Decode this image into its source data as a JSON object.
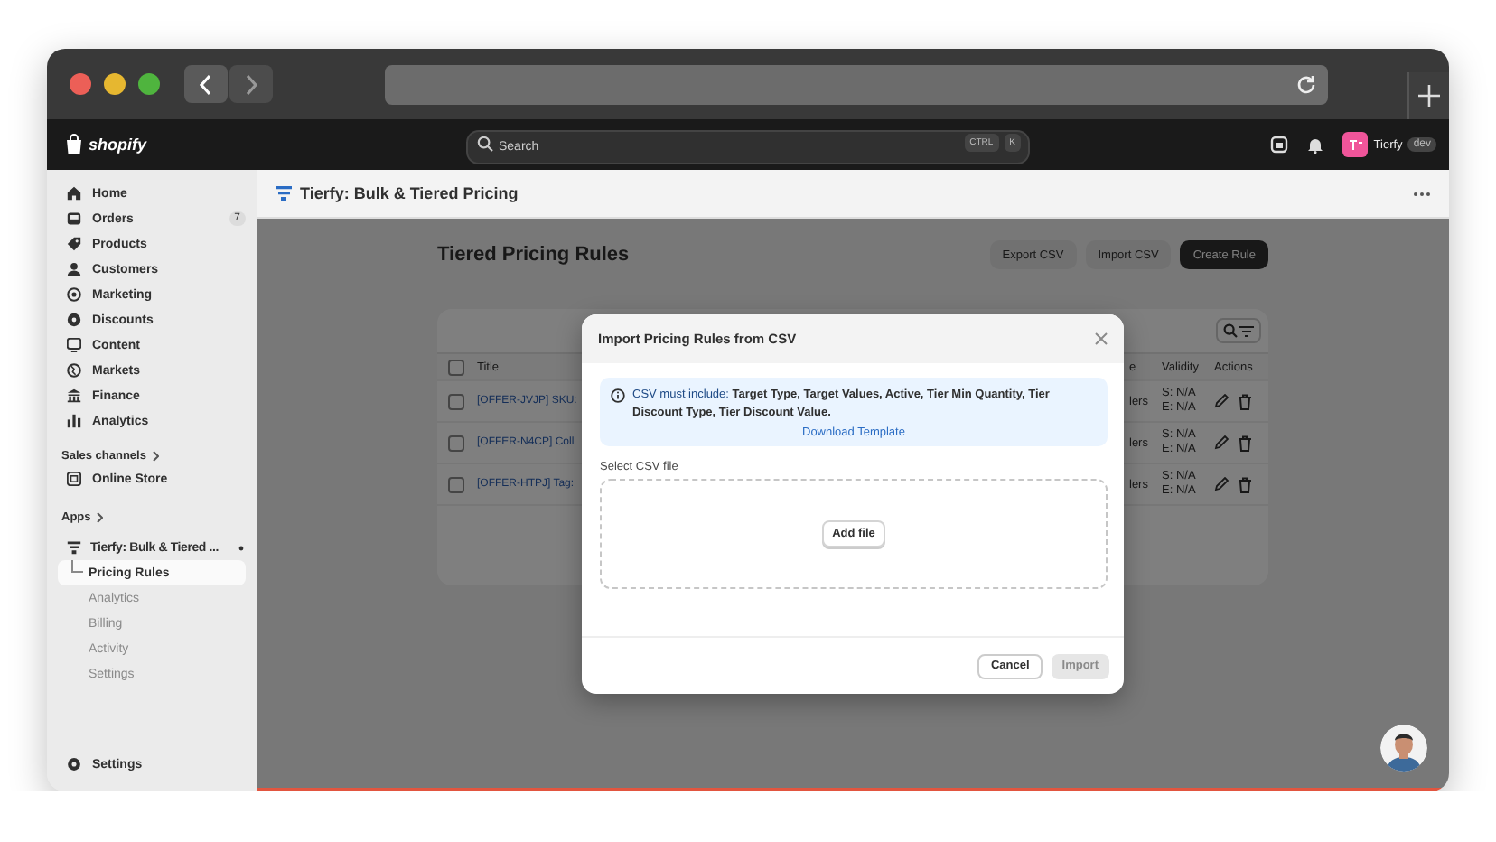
{
  "topbar": {
    "logo_text": "shopify",
    "search": {
      "placeholder": "Search",
      "shortcut": [
        "CTRL",
        "K"
      ]
    },
    "store": {
      "name": "Tierfy",
      "badge": "dev"
    }
  },
  "sidebar": {
    "items": [
      {
        "label": "Home"
      },
      {
        "label": "Orders",
        "badge": "7"
      },
      {
        "label": "Products"
      },
      {
        "label": "Customers"
      },
      {
        "label": "Marketing"
      },
      {
        "label": "Discounts"
      },
      {
        "label": "Content"
      },
      {
        "label": "Markets"
      },
      {
        "label": "Finance"
      },
      {
        "label": "Analytics"
      }
    ],
    "sales_channels": {
      "heading": "Sales channels",
      "items": [
        {
          "label": "Online Store"
        }
      ]
    },
    "apps": {
      "heading": "Apps",
      "items": [
        {
          "label": "Tierfy: Bulk & Tiered ...",
          "expanded": true,
          "children": [
            {
              "label": "Pricing Rules",
              "selected": true
            },
            {
              "label": "Analytics",
              "selected": false
            },
            {
              "label": "Billing",
              "selected": false
            },
            {
              "label": "Activity",
              "selected": false
            },
            {
              "label": "Settings",
              "selected": false
            }
          ]
        }
      ]
    },
    "footer": {
      "label": "Settings"
    }
  },
  "app_header": {
    "title": "Tierfy: Bulk & Tiered Pricing"
  },
  "page": {
    "title": "Tiered Pricing Rules",
    "buttons": [
      {
        "label": "Export CSV",
        "kind": "secondary"
      },
      {
        "label": "Import CSV",
        "kind": "secondary"
      },
      {
        "label": "Create Rule",
        "kind": "primary"
      }
    ],
    "table": {
      "select_all_checked": false,
      "columns": [
        "Title",
        "e",
        "Validity",
        "Actions"
      ],
      "rows": [
        {
          "title": "[OFFER-JVJP] SKU:",
          "column_2": "lers",
          "validity": [
            "S: N/A",
            "E: N/A"
          ],
          "checked": false
        },
        {
          "title": "[OFFER-N4CP] Coll",
          "column_2": "lers",
          "validity": [
            "S: N/A",
            "E: N/A"
          ],
          "checked": false
        },
        {
          "title": "[OFFER-HTPJ] Tag:",
          "column_2": "lers",
          "validity": [
            "S: N/A",
            "E: N/A"
          ],
          "checked": false
        }
      ]
    }
  },
  "modal": {
    "title": "Import Pricing Rules from CSV",
    "notice": {
      "text": "CSV must include: **Target Type, Target Values, Active, Tier Min Quantity, Tier Discount Type, Tier Discount Value.**",
      "link": "Download Template"
    },
    "field_label": "Select CSV file",
    "dropzone_button": "Add file",
    "buttons": [
      {
        "label": "Cancel",
        "kind": "secondary",
        "disabled": false
      },
      {
        "label": "Import",
        "kind": "primary",
        "disabled": true
      }
    ]
  }
}
